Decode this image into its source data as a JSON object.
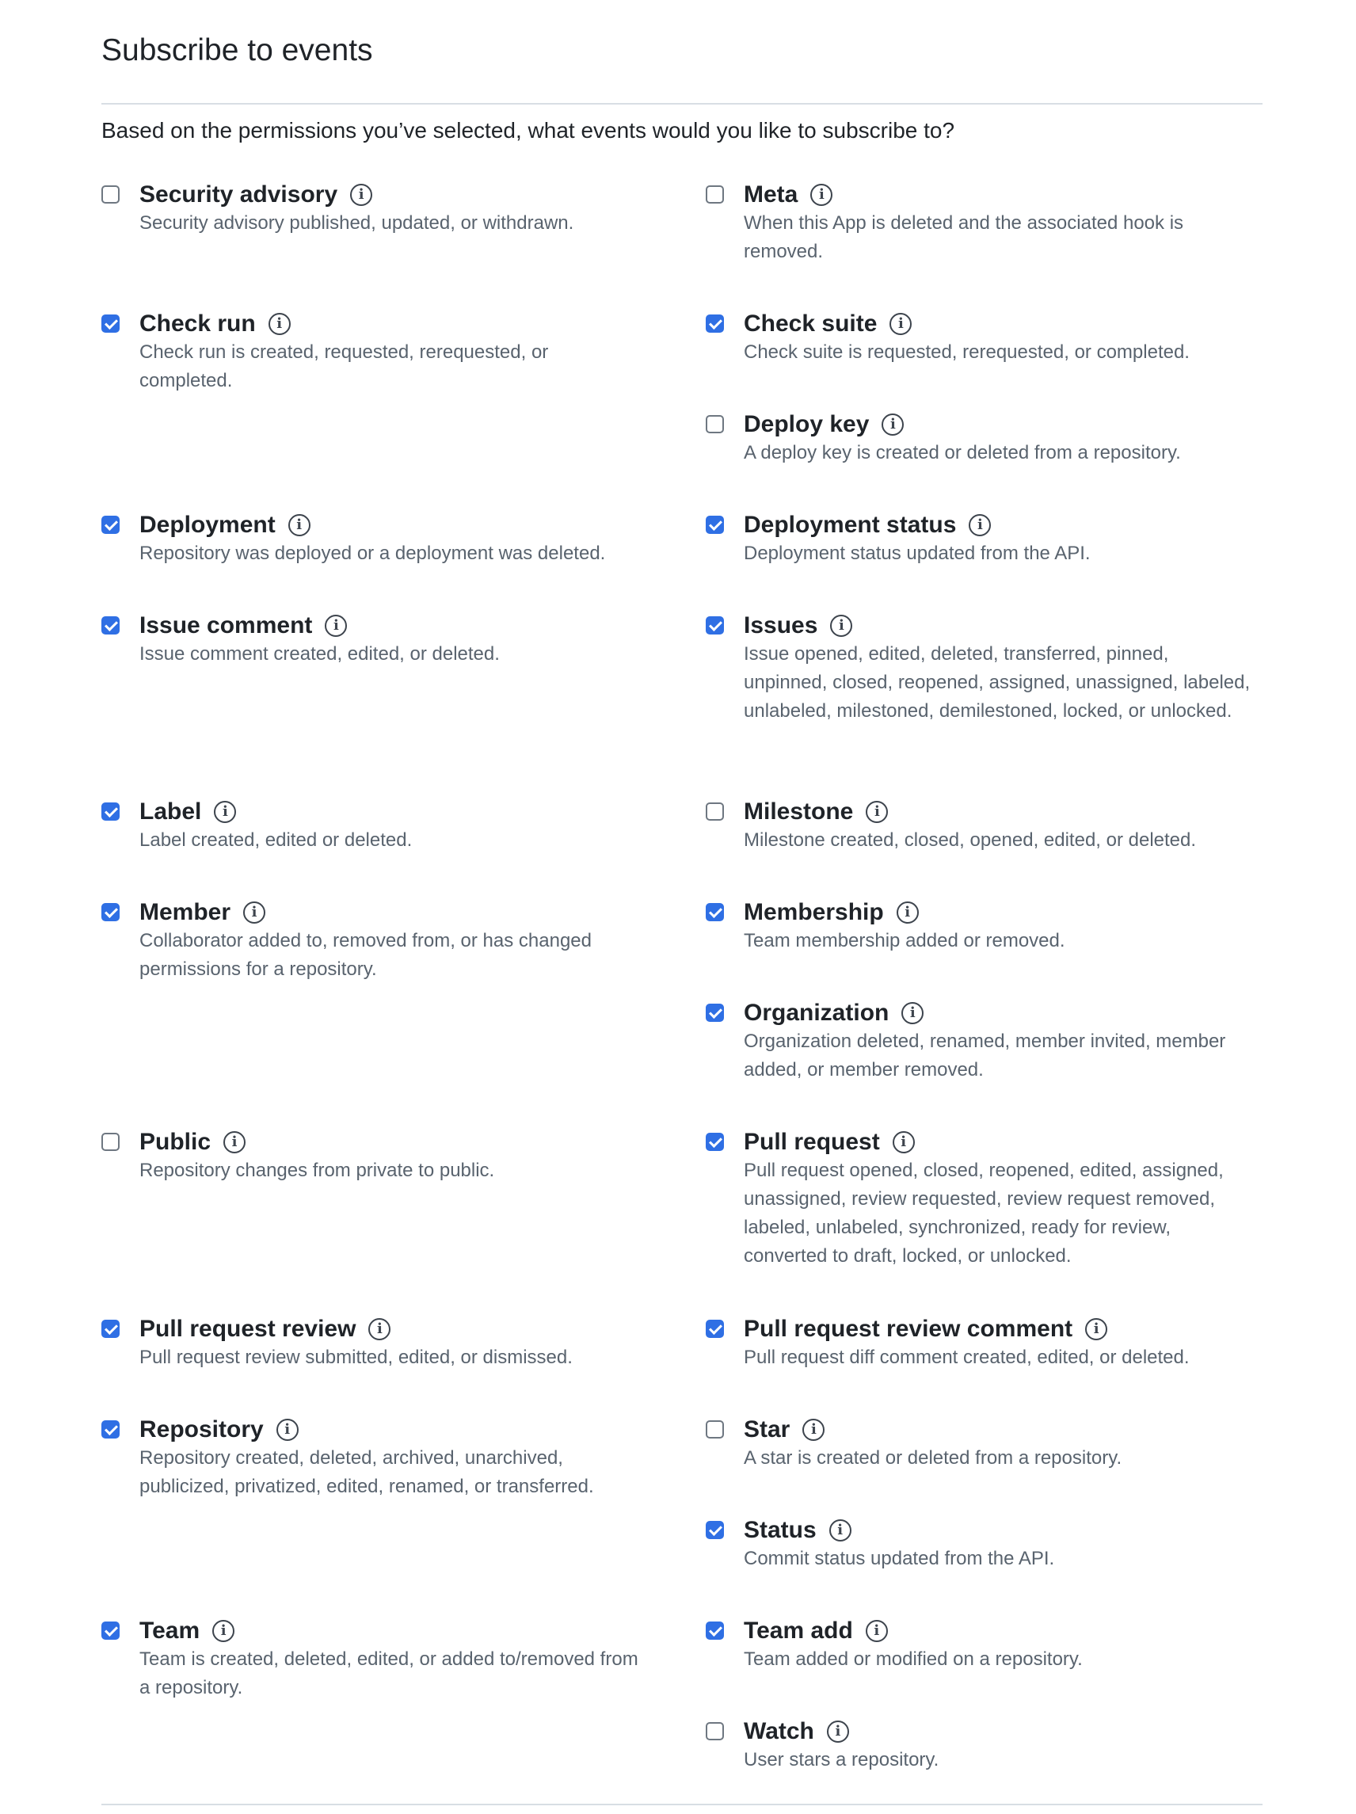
{
  "header": {
    "title": "Subscribe to events",
    "intro": "Based on the permissions you’ve selected, what events would you like to subscribe to?"
  },
  "info_icon": "info-circle-icon",
  "colors": {
    "checked": "#2f6fe4",
    "text": "#1f2328",
    "muted": "#59636e"
  },
  "events": {
    "security_advisory": {
      "title": "Security advisory",
      "checked": false,
      "desc": "Security advisory published, updated, or withdrawn."
    },
    "meta": {
      "title": "Meta",
      "checked": false,
      "desc": "When this App is deleted and the associated hook is removed."
    },
    "check_run": {
      "title": "Check run",
      "checked": true,
      "desc": "Check run is created, requested, rerequested, or completed."
    },
    "check_suite": {
      "title": "Check suite",
      "checked": true,
      "desc": "Check suite is requested, rerequested, or completed."
    },
    "deploy_key": {
      "title": "Deploy key",
      "checked": false,
      "desc": "A deploy key is created or deleted from a repository."
    },
    "deployment": {
      "title": "Deployment",
      "checked": true,
      "desc": "Repository was deployed or a deployment was deleted."
    },
    "deployment_status": {
      "title": "Deployment status",
      "checked": true,
      "desc": "Deployment status updated from the API."
    },
    "issue_comment": {
      "title": "Issue comment",
      "checked": true,
      "desc": "Issue comment created, edited, or deleted."
    },
    "issues": {
      "title": "Issues",
      "checked": true,
      "desc": "Issue opened, edited, deleted, transferred, pinned, unpinned, closed, reopened, assigned, unassigned, labeled, unlabeled, milestoned, demilestoned, locked, or unlocked."
    },
    "label": {
      "title": "Label",
      "checked": true,
      "desc": "Label created, edited or deleted."
    },
    "milestone": {
      "title": "Milestone",
      "checked": false,
      "desc": "Milestone created, closed, opened, edited, or deleted."
    },
    "member": {
      "title": "Member",
      "checked": true,
      "desc": "Collaborator added to, removed from, or has changed permissions for a repository."
    },
    "membership": {
      "title": "Membership",
      "checked": true,
      "desc": "Team membership added or removed."
    },
    "organization": {
      "title": "Organization",
      "checked": true,
      "desc": "Organization deleted, renamed, member invited, member added, or member removed."
    },
    "public": {
      "title": "Public",
      "checked": false,
      "desc": "Repository changes from private to public."
    },
    "pull_request": {
      "title": "Pull request",
      "checked": true,
      "desc": "Pull request opened, closed, reopened, edited, assigned, unassigned, review requested, review request removed, labeled, unlabeled, synchronized, ready for review, converted to draft, locked, or unlocked."
    },
    "pull_request_review": {
      "title": "Pull request review",
      "checked": true,
      "desc": "Pull request review submitted, edited, or dismissed."
    },
    "pull_request_review_comment": {
      "title": "Pull request review comment",
      "checked": true,
      "desc": "Pull request diff comment created, edited, or deleted."
    },
    "repository": {
      "title": "Repository",
      "checked": true,
      "desc": "Repository created, deleted, archived, unarchived, publicized, privatized, edited, renamed, or transferred."
    },
    "star": {
      "title": "Star",
      "checked": false,
      "desc": "A star is created or deleted from a repository."
    },
    "status": {
      "title": "Status",
      "checked": true,
      "desc": "Commit status updated from the API."
    },
    "team": {
      "title": "Team",
      "checked": true,
      "desc": "Team is created, deleted, edited, or added to/removed from a repository."
    },
    "team_add": {
      "title": "Team add",
      "checked": true,
      "desc": "Team added or modified on a repository."
    },
    "watch": {
      "title": "Watch",
      "checked": false,
      "desc": "User stars a repository."
    }
  }
}
